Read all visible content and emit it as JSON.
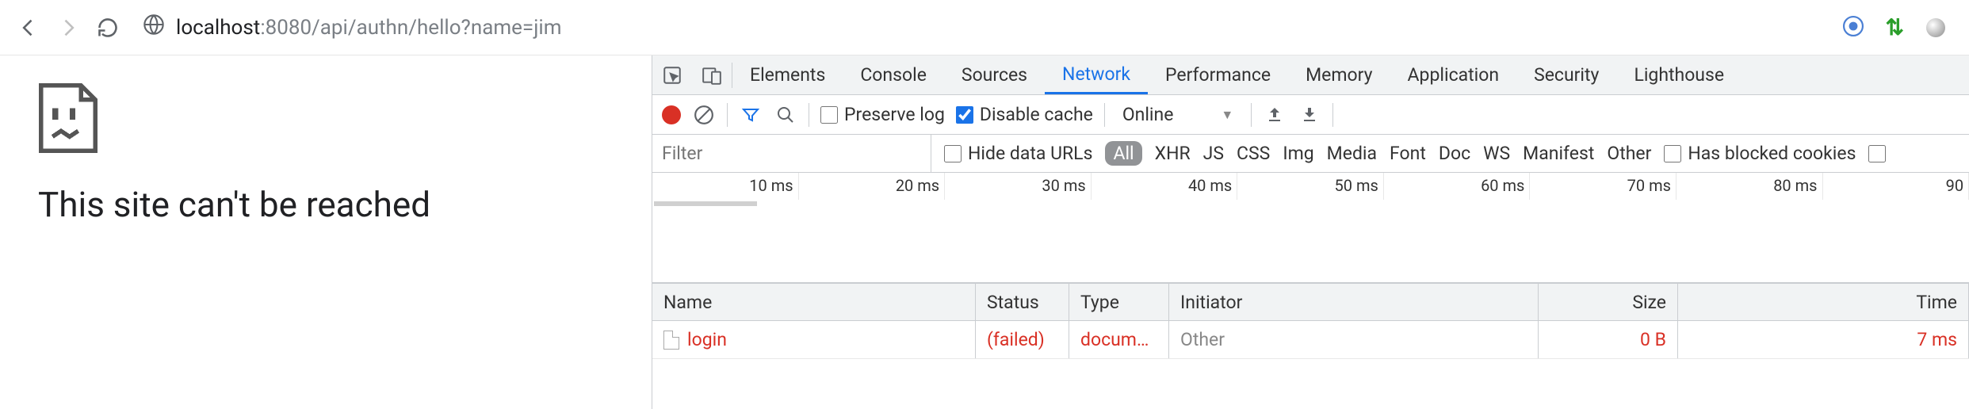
{
  "address": {
    "host": "localhost",
    "rest": ":8080/api/authn/hello?name=jim"
  },
  "page": {
    "title_partial": "This site can't be reached"
  },
  "devtools_tabs": [
    "Elements",
    "Console",
    "Sources",
    "Network",
    "Performance",
    "Memory",
    "Application",
    "Security",
    "Lighthouse"
  ],
  "devtools_active_tab": "Network",
  "net_toolbar": {
    "preserve_log": "Preserve log",
    "disable_cache": "Disable cache",
    "throttle": "Online"
  },
  "filter": {
    "placeholder": "Filter",
    "hide_urls": "Hide data URLs",
    "types": [
      "All",
      "XHR",
      "JS",
      "CSS",
      "Img",
      "Media",
      "Font",
      "Doc",
      "WS",
      "Manifest",
      "Other"
    ],
    "has_blocked": "Has blocked cookies"
  },
  "timeline_ticks": [
    "10 ms",
    "20 ms",
    "30 ms",
    "40 ms",
    "50 ms",
    "60 ms",
    "70 ms",
    "80 ms",
    "90"
  ],
  "req_columns": [
    "Name",
    "Status",
    "Type",
    "Initiator",
    "Size",
    "Time"
  ],
  "requests": [
    {
      "name": "login",
      "status": "(failed)",
      "type": "docum…",
      "initiator": "Other",
      "size": "0 B",
      "time": "7 ms",
      "failed": true
    }
  ]
}
